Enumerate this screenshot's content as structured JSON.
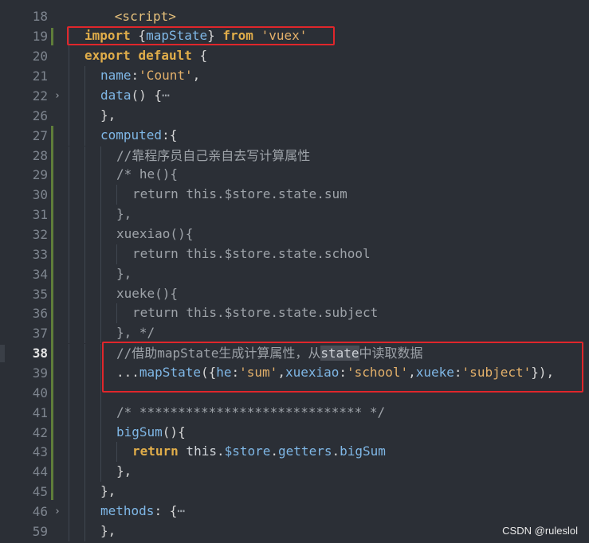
{
  "editor": {
    "lines": [
      {
        "num": "18"
      },
      {
        "num": "19"
      },
      {
        "num": "20"
      },
      {
        "num": "21"
      },
      {
        "num": "22",
        "fold": "›"
      },
      {
        "num": "26"
      },
      {
        "num": "27"
      },
      {
        "num": "28"
      },
      {
        "num": "29"
      },
      {
        "num": "30"
      },
      {
        "num": "31"
      },
      {
        "num": "32"
      },
      {
        "num": "33"
      },
      {
        "num": "34"
      },
      {
        "num": "35"
      },
      {
        "num": "36"
      },
      {
        "num": "37"
      },
      {
        "num": "38"
      },
      {
        "num": "39"
      },
      {
        "num": "40"
      },
      {
        "num": "41"
      },
      {
        "num": "42"
      },
      {
        "num": "43"
      },
      {
        "num": "44"
      },
      {
        "num": "45"
      },
      {
        "num": "46",
        "fold": "›"
      },
      {
        "num": "59"
      }
    ],
    "tokens": {
      "l18": {
        "a": "<script>"
      },
      "l19": {
        "a": "import",
        "b": " {",
        "c": "mapState",
        "d": "} ",
        "e": "from",
        "f": " ",
        "g": "'vuex'"
      },
      "l20": {
        "a": "export",
        "b": " ",
        "c": "default",
        "d": " {"
      },
      "l21": {
        "a": "name",
        "b": ":",
        "c": "'Count'",
        "d": ","
      },
      "l22": {
        "a": "data",
        "b": "() {",
        "c": "⋯"
      },
      "l26": {
        "a": "},"
      },
      "l27": {
        "a": "computed",
        "b": ":{"
      },
      "l28": {
        "a": "//靠程序员自己亲自去写计算属性"
      },
      "l29": {
        "a": "/* he(){"
      },
      "l30": {
        "a": "return this.$store.state.sum"
      },
      "l31": {
        "a": "},"
      },
      "l32": {
        "a": "xuexiao(){"
      },
      "l33": {
        "a": "return this.$store.state.school"
      },
      "l34": {
        "a": "},"
      },
      "l35": {
        "a": "xueke(){"
      },
      "l36": {
        "a": "return this.$store.state.subject"
      },
      "l37": {
        "a": "}, */"
      },
      "l38": {
        "a": "//借助mapState生成计算属性，从",
        "b": "state",
        "c": "中读取数据"
      },
      "l39": {
        "a": "...",
        "b": "mapState",
        "c": "({",
        "d": "he",
        "e": ":",
        "f": "'sum'",
        "g": ",",
        "h": "xuexiao",
        "i": ":",
        "j": "'school'",
        "k": ",",
        "l": "xueke",
        "m": ":",
        "n": "'subject'",
        "o": "}),"
      },
      "l41": {
        "a": "/* ***************************** */"
      },
      "l42": {
        "a": "bigSum",
        "b": "(){"
      },
      "l43": {
        "a": "return",
        "b": " this.",
        "c": "$store",
        "d": ".",
        "e": "getters",
        "f": ".",
        "g": "bigSum"
      },
      "l44": {
        "a": "},"
      },
      "l45": {
        "a": "},"
      },
      "l46": {
        "a": "methods",
        "b": ": {",
        "c": "⋯"
      },
      "l59": {
        "a": "},"
      }
    }
  },
  "watermark": "CSDN @ruleslol",
  "colors": {
    "highlight_box": "#e0262b",
    "background": "#2b2f36"
  }
}
